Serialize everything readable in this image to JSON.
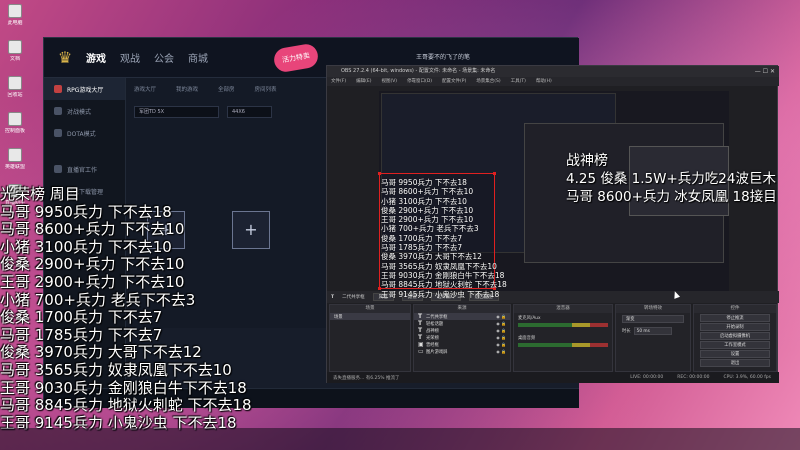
{
  "desktop": {
    "icons": [
      {
        "label": "此电脑"
      },
      {
        "label": "文档"
      },
      {
        "label": "回收站"
      },
      {
        "label": "控制面板"
      },
      {
        "label": "英雄联盟"
      },
      {
        "label": "直播助手"
      }
    ]
  },
  "game_client": {
    "nav": [
      "游戏",
      "观战",
      "公会",
      "商城"
    ],
    "badge": "活力特卖",
    "user": "王哥要不的飞了的笔",
    "sidebar": [
      "RPG游戏大厅",
      "对战模式",
      "DOTA模式",
      "直播官工作",
      "游戏下载管理"
    ],
    "tabs": [
      "游戏大厅",
      "我的游戏",
      "全部房",
      "房间列表"
    ],
    "filters": [
      "军团TD 5X",
      "44X6"
    ],
    "slot_glyph": "+"
  },
  "obs": {
    "title": "OBS 27.2.4 (64-bit, windows) - 配置文件: 未命名 - 场景集: 未命名",
    "menu": [
      "文件(F)",
      "编辑(E)",
      "视图(V)",
      "停靠窗口(D)",
      "配置文件(P)",
      "场景集合(S)",
      "工具(T)",
      "帮助(H)"
    ],
    "source_bar": {
      "selected": "二代共享框",
      "props": "属性",
      "filters": "滤镜",
      "choose": "选择窗口",
      "selected_area": "选区截图"
    },
    "docks": {
      "scenes": "场景",
      "sources": "来源",
      "mixer": "混音器",
      "transitions": "转场特效",
      "controls": "控件"
    },
    "sources_list": [
      "二代共享框",
      "轻松话题",
      "战神榜",
      "光荣榜",
      "曾经框",
      "图片游戏屏"
    ],
    "mixer_tracks": [
      "麦克风/Aux",
      "桌面音频"
    ],
    "transition": {
      "type": "渐变",
      "duration_label": "时长",
      "duration": "50 ms"
    },
    "control_buttons": [
      "停止推流",
      "开始录制",
      "启动虚拟摄像机",
      "工作室模式",
      "设置",
      "退出"
    ],
    "status": {
      "notice": "丢失直播服务... 有6.25% 推流了",
      "live": "LIVE: 00:00:00",
      "rec": "REC: 00:00:00",
      "cpu": "CPU: 3.9%, 60.00 fps"
    }
  },
  "overlay": {
    "main_list": [
      "光荣榜    周目",
      "马哥 9950兵力 下不去18",
      "马哥 8600+兵力 下不去10",
      "小猪 3100兵力 下不去10",
      "俊桑 2900+兵力 下不去10",
      "王哥 2900+兵力 下不去10",
      "小猪 700+兵力 老兵下不去3",
      "俊桑 1700兵力 下不去7",
      "马哥 1785兵力 下不去7",
      "俊桑 3970兵力 大哥下不去12",
      "马哥 3565兵力 奴隶凤凰下不去10",
      "王哥 9030兵力 金刚狼白牛下不去18",
      "马哥 8845兵力 地狱火刺蛇 下不去18",
      "王哥 9145兵力 小鬼沙虫 下不去18"
    ],
    "right_list": [
      "战神榜",
      "4.25 俊桑 1.5W+兵力吃24波巨木",
      "马哥 8600+兵力 冰女凤凰 18接目"
    ]
  }
}
